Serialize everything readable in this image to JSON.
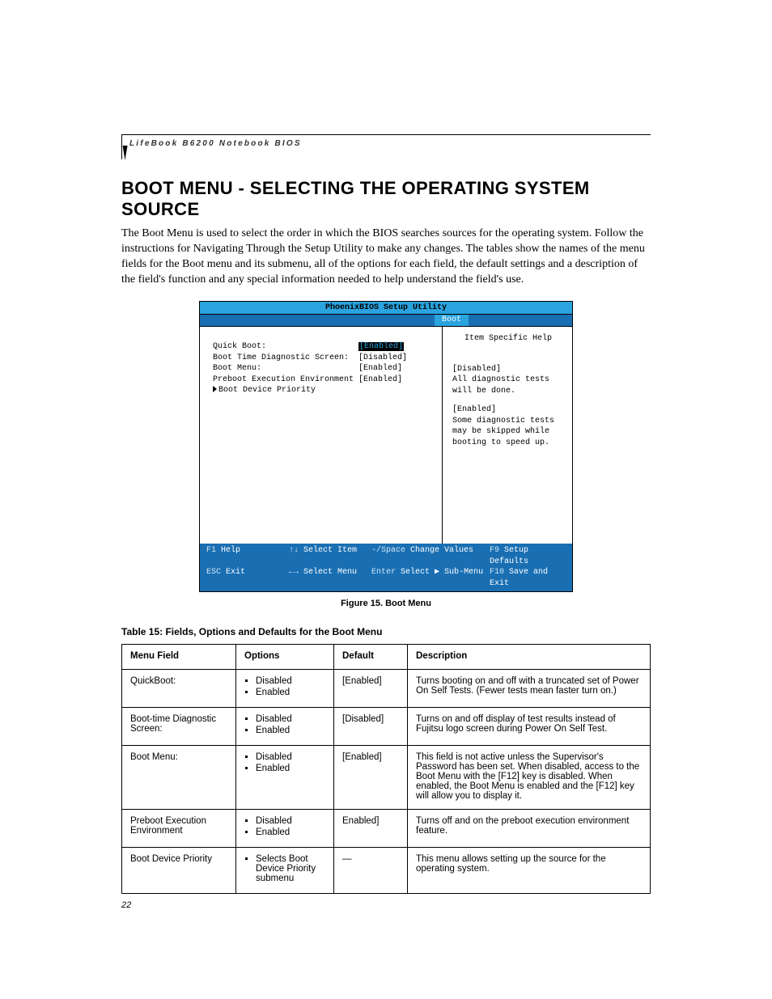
{
  "running_head": "LifeBook B6200 Notebook BIOS",
  "section_title": "BOOT MENU - SELECTING THE OPERATING SYSTEM SOURCE",
  "intro": "The Boot Menu is used to select the order in which the BIOS searches sources for the operating system. Follow the instructions for Navigating Through the Setup Utility to make any changes. The tables show the names of the menu fields for the Boot menu and its submenu, all of the options for each field, the default settings and a description of the field's function and any special information needed to help understand the field's use.",
  "figure_caption": "Figure 15.  Boot Menu",
  "table_title": "Table 15: Fields, Options and Defaults for the Boot Menu",
  "page_number": "22",
  "bios": {
    "title": "PhoenixBIOS Setup Utility",
    "active_tab": "Boot",
    "settings": [
      {
        "label": "Quick Boot:",
        "value": "[Enabled]",
        "selected": true
      },
      {
        "label": "Boot Time Diagnostic Screen:",
        "value": "[Disabled]",
        "selected": false
      },
      {
        "label": "Boot Menu:",
        "value": "[Enabled]",
        "selected": false
      },
      {
        "label": "Preboot Execution Environment",
        "value": "[Enabled]",
        "selected": false
      }
    ],
    "submenu": "Boot Device Priority",
    "help_title": "Item Specific Help",
    "help_disabled_label": "[Disabled]",
    "help_disabled_text": "All diagnostic tests will be done.",
    "help_enabled_label": "[Enabled]",
    "help_enabled_text": "Some diagnostic tests may be skipped while booting to speed up.",
    "footer": {
      "f1": "F1",
      "f1_t": "Help",
      "ud": "↑↓",
      "ud_t": "Select Item",
      "pm": "-/Space",
      "pm_t": "Change Values",
      "f9": "F9",
      "f9_t": "Setup Defaults",
      "esc": "ESC",
      "esc_t": "Exit",
      "lr": "←→",
      "lr_t": "Select Menu",
      "ent": "Enter",
      "ent_t": "Select ▶ Sub-Menu",
      "f10": "F10",
      "f10_t": "Save and Exit"
    }
  },
  "table": {
    "headers": [
      "Menu Field",
      "Options",
      "Default",
      "Description"
    ],
    "rows": [
      {
        "menu": "QuickBoot:",
        "options": [
          "Disabled",
          "Enabled"
        ],
        "default": "[Enabled]",
        "desc": "Turns booting on and off with a truncated set of Power On Self Tests. (Fewer tests mean faster turn on.)"
      },
      {
        "menu": "Boot-time Diagnostic Screen:",
        "options": [
          "Disabled",
          "Enabled"
        ],
        "default": "[Disabled]",
        "desc": "Turns on and off display of test results instead of Fujitsu logo screen during Power On Self Test."
      },
      {
        "menu": "Boot Menu:",
        "options": [
          "Disabled",
          "Enabled"
        ],
        "default": "[Enabled]",
        "desc": "This field is not active unless the Supervisor's Password has been set. When disabled, access to the Boot Menu with the [F12] key is disabled. When enabled, the Boot Menu is enabled and the [F12] key will allow you to display it."
      },
      {
        "menu": "Preboot Execution Environment",
        "options": [
          "Disabled",
          "Enabled"
        ],
        "default": "Enabled]",
        "desc": "Turns off and on the preboot execution environment feature."
      },
      {
        "menu": "Boot Device Priority",
        "options": [
          "Selects Boot Device Priority submenu"
        ],
        "default": "—",
        "desc": "This menu allows setting up the source for the operating system."
      }
    ]
  }
}
